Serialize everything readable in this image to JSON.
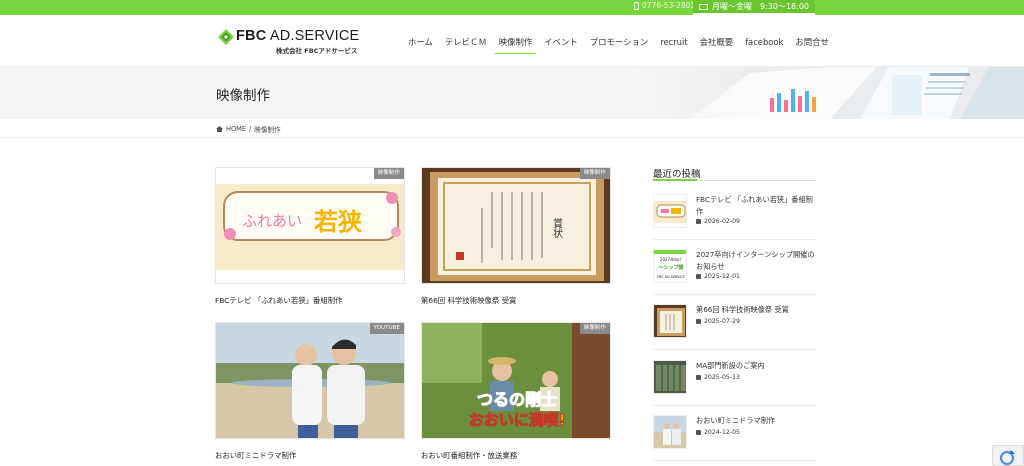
{
  "topbar": {
    "phone": "0776-53-2801",
    "hours": "月曜〜金曜　9:30〜18:00"
  },
  "header": {
    "logo_main_bold": "FBC",
    "logo_main_rest": " AD.SERVICE",
    "logo_sub": "株式会社 FBCアドサービス",
    "nav": [
      {
        "label": "ホーム"
      },
      {
        "label": "テレビＣＭ"
      },
      {
        "label": "映像制作"
      },
      {
        "label": "イベント"
      },
      {
        "label": "プロモーション"
      },
      {
        "label": "recruit"
      },
      {
        "label": "会社概要"
      },
      {
        "label": "facebook"
      },
      {
        "label": "お問合せ"
      }
    ],
    "active_nav": "映像制作"
  },
  "page": {
    "title": "映像制作"
  },
  "breadcrumb": {
    "home": "HOME",
    "sep": "/",
    "current": "映像制作"
  },
  "cards": [
    {
      "badge": "映像制作",
      "title": "FBCテレビ 「ふれあい若狭」番組制作",
      "thumb_text_a": "ふれあい",
      "thumb_text_b": "若狭"
    },
    {
      "badge": "映像制作",
      "title": "第66回 科学技術映像祭 受賞",
      "thumb_text_a": "賞状"
    },
    {
      "badge": "YOUTUBE",
      "title": "おおい町ミニドラマ制作"
    },
    {
      "badge": "映像制作",
      "title": "おおい町番組制作・放送業務",
      "thumb_text_a": "つるの剛士",
      "thumb_text_b": "おおいに満喫!"
    }
  ],
  "sidebar": {
    "title": "最近の投稿",
    "posts": [
      {
        "title": "FBCテレビ 「ふれあい若狭」番組制作",
        "date": "2026-02-09"
      },
      {
        "title": "2027卒向けインターンシップ開催のお知らせ",
        "date": "2025-12-01",
        "thumb_text_a": "2027卒向け",
        "thumb_text_b": "〜シップ開",
        "thumb_text_c": "FBC AD.SERVICE"
      },
      {
        "title": "第66回 科学技術映像祭 受賞",
        "date": "2025-07-29"
      },
      {
        "title": "MA部門新設のご案内",
        "date": "2025-05-13"
      },
      {
        "title": "おおい町ミニドラマ制作",
        "date": "2024-12-05"
      }
    ]
  },
  "colors": {
    "brand_green": "#7ad63f",
    "badge_gray": "#8a8a8a"
  }
}
